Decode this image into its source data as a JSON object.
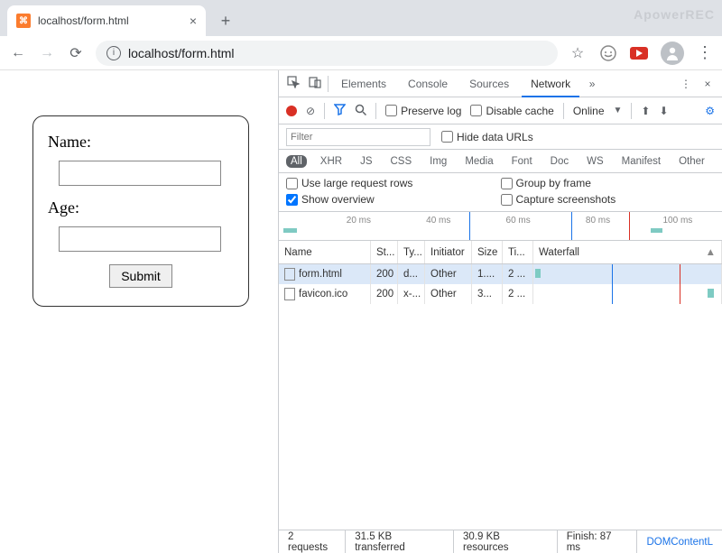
{
  "watermark": "ApowerREC",
  "tab": {
    "title": "localhost/form.html"
  },
  "url": "localhost/form.html",
  "form": {
    "name_label": "Name:",
    "age_label": "Age:",
    "submit": "Submit"
  },
  "devtools": {
    "tabs": [
      "Elements",
      "Console",
      "Sources",
      "Network"
    ],
    "active_tab": "Network",
    "controls": {
      "preserve": "Preserve log",
      "disable_cache": "Disable cache",
      "online": "Online"
    },
    "filter_placeholder": "Filter",
    "hide_urls": "Hide data URLs",
    "types": [
      "All",
      "XHR",
      "JS",
      "CSS",
      "Img",
      "Media",
      "Font",
      "Doc",
      "WS",
      "Manifest",
      "Other"
    ],
    "opts": {
      "large_rows": "Use large request rows",
      "group": "Group by frame",
      "overview": "Show overview",
      "capture": "Capture screenshots"
    },
    "ruler_labels": [
      "20 ms",
      "40 ms",
      "60 ms",
      "80 ms",
      "100 ms"
    ],
    "columns": {
      "name": "Name",
      "status": "St...",
      "type": "Ty...",
      "initiator": "Initiator",
      "size": "Size",
      "time": "Ti...",
      "waterfall": "Waterfall"
    },
    "rows": [
      {
        "name": "form.html",
        "status": "200",
        "type": "d...",
        "initiator": "Other",
        "size": "1....",
        "time": "2 ..."
      },
      {
        "name": "favicon.ico",
        "status": "200",
        "type": "x-...",
        "initiator": "Other",
        "size": "3...",
        "time": "2 ..."
      }
    ],
    "status": {
      "requests": "2 requests",
      "transferred": "31.5 KB transferred",
      "resources": "30.9 KB resources",
      "finish": "Finish: 87 ms",
      "dom": "DOMContentL"
    }
  }
}
